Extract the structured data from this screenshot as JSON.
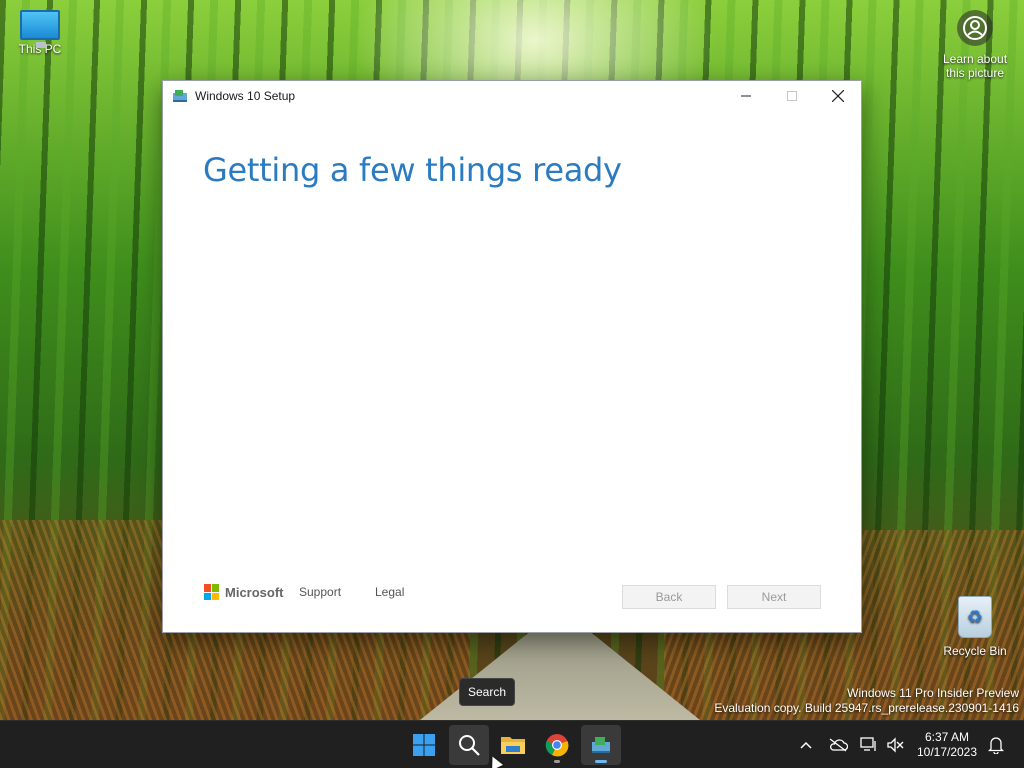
{
  "desktop": {
    "this_pc_label": "This PC",
    "learn_label": "Learn about this picture",
    "recycle_label": "Recycle Bin",
    "watermark_line1": "Windows 11 Pro Insider Preview",
    "watermark_line2": "Evaluation copy. Build 25947.rs_prerelease.230901-1416"
  },
  "setup_window": {
    "title": "Windows 10 Setup",
    "heading": "Getting a few things ready",
    "brand": "Microsoft",
    "support_link": "Support",
    "legal_link": "Legal",
    "back_label": "Back",
    "next_label": "Next"
  },
  "tooltip": {
    "text": "Search"
  },
  "taskbar": {
    "time": "6:37 AM",
    "date": "10/17/2023",
    "pinned": [
      "start-icon",
      "search-icon",
      "file-explorer-icon",
      "chrome-icon",
      "windows-setup-icon"
    ]
  }
}
